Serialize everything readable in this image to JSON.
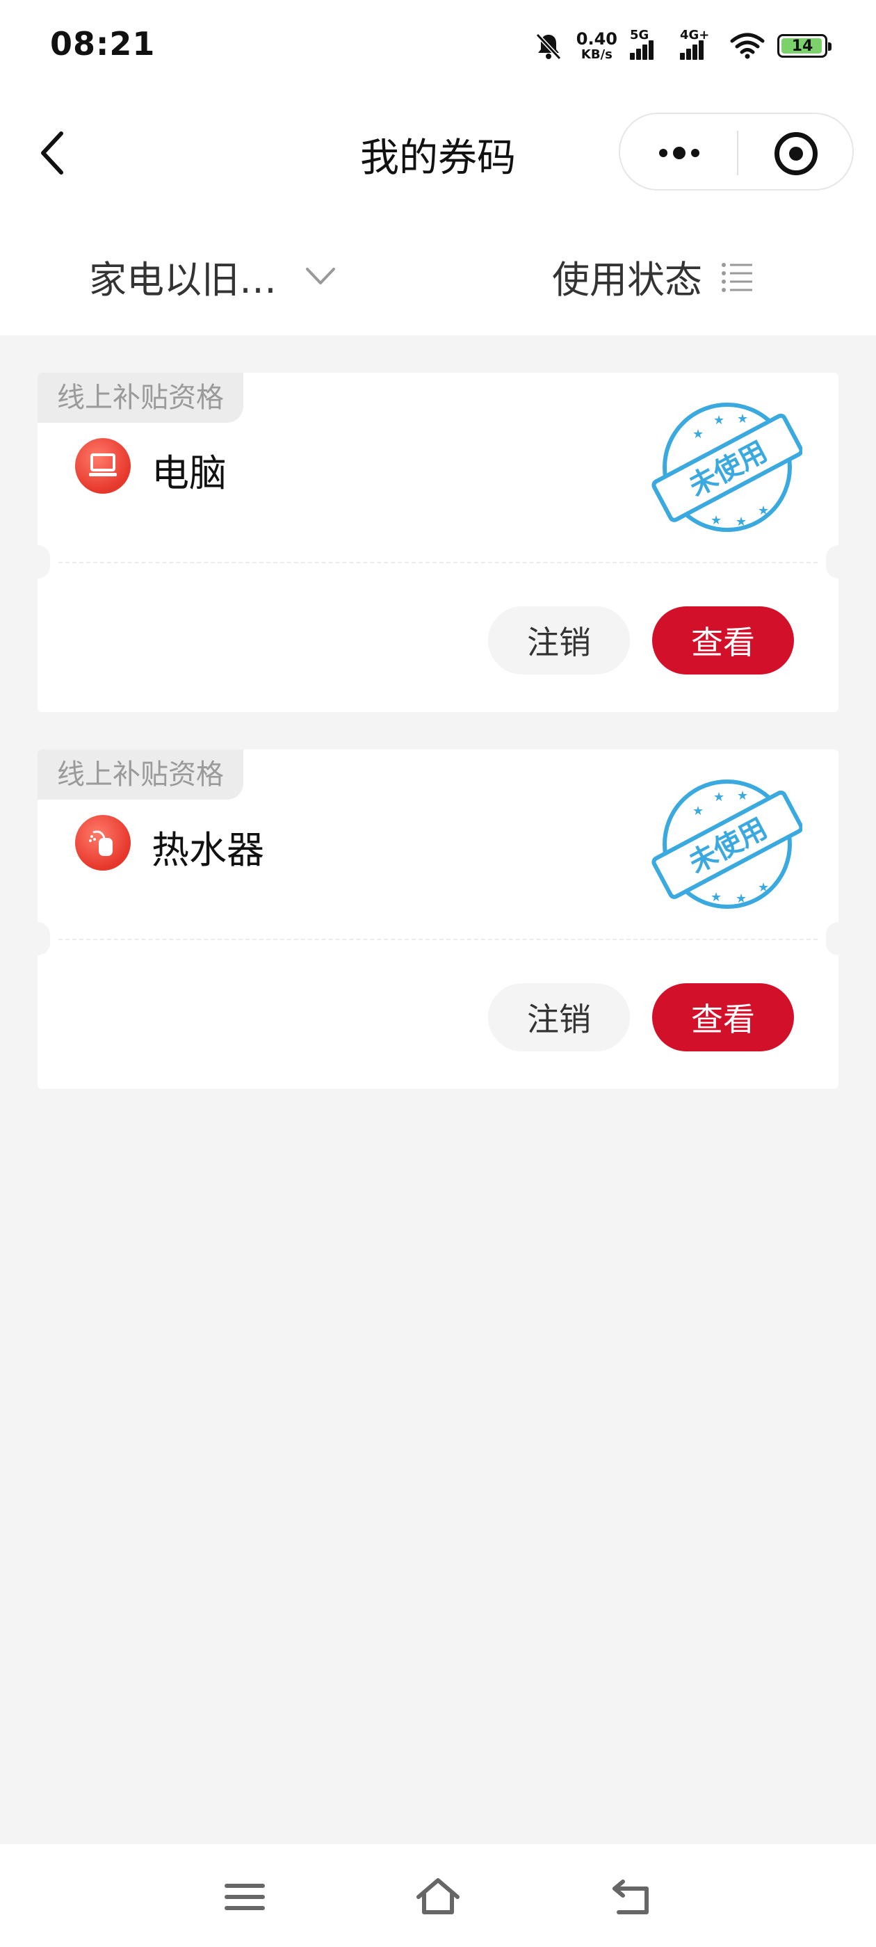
{
  "status_bar": {
    "time": "08:21",
    "net_speed_value": "0.40",
    "net_speed_unit": "KB/s",
    "sim1_label": "5G",
    "sim2_label": "4G+",
    "battery": "14",
    "icons": [
      "bell-muted-icon",
      "signal-icon",
      "wifi-icon",
      "battery-icon"
    ]
  },
  "nav": {
    "title": "我的券码",
    "icons": [
      "back-arrow-icon",
      "more-dots-icon",
      "target-icon"
    ]
  },
  "filters": {
    "category": "家电以旧…",
    "status": "使用状态",
    "icons": [
      "chevron-down-icon",
      "list-icon"
    ]
  },
  "cards": [
    {
      "tag": "线上补贴资格",
      "name": "电脑",
      "icon": "computer-icon",
      "stamp": "未使用",
      "cancel_label": "注销",
      "view_label": "查看"
    },
    {
      "tag": "线上补贴资格",
      "name": "热水器",
      "icon": "water-heater-icon",
      "stamp": "未使用",
      "cancel_label": "注销",
      "view_label": "查看"
    }
  ],
  "colors": {
    "accent": "#d2102a",
    "stamp_blue": "#3aa9e0",
    "background": "#f4f4f4"
  },
  "system_nav": {
    "icons": [
      "menu-icon",
      "home-icon",
      "back-icon"
    ]
  }
}
